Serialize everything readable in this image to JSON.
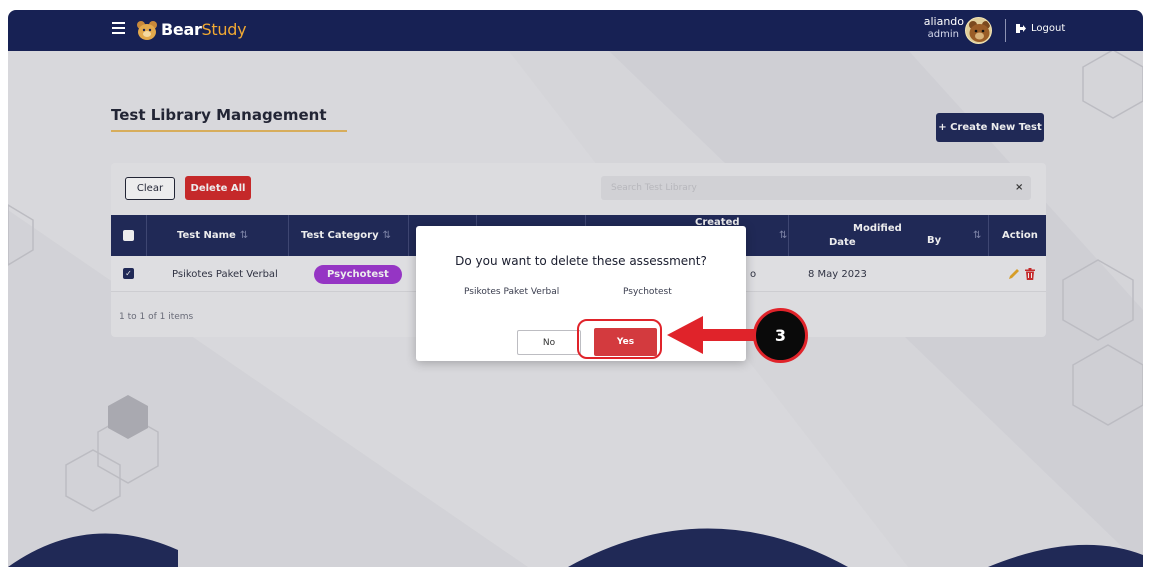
{
  "navbar": {
    "brand_part1": "Bear",
    "brand_part2": "Study",
    "user_name": "aliando",
    "user_role": "admin",
    "logout_label": "Logout"
  },
  "page": {
    "title": "Test Library Management",
    "create_button": "+ Create New Test"
  },
  "toolbar": {
    "clear_label": "Clear",
    "delete_all_label": "Delete All",
    "search_placeholder": "Search Test Library",
    "search_clear": "×"
  },
  "table": {
    "headers": {
      "test_name": "Test Name",
      "test_category": "Test Category",
      "created": "Created",
      "modified": "Modified",
      "modified_date": "Date",
      "modified_by": "By",
      "action": "Action"
    },
    "sort_glyph": "⇅",
    "rows": [
      {
        "test_name": "Psikotes Paket Verbal",
        "test_category": "Psychotest",
        "created_by_fragment": "o",
        "modified_date": "8 May 2023",
        "checked": true
      }
    ],
    "pager": "1 to 1 of 1 items"
  },
  "modal": {
    "question": "Do you want to delete these assessment?",
    "item_name": "Psikotes Paket Verbal",
    "item_category": "Psychotest",
    "no_label": "No",
    "yes_label": "Yes"
  },
  "annotation": {
    "step_number": "3"
  },
  "colors": {
    "navy": "#172154",
    "accent_gold": "#f0a833",
    "danger": "#d32121",
    "badge_purple": "#9c2fd1",
    "annotation_red": "#e0232a"
  }
}
